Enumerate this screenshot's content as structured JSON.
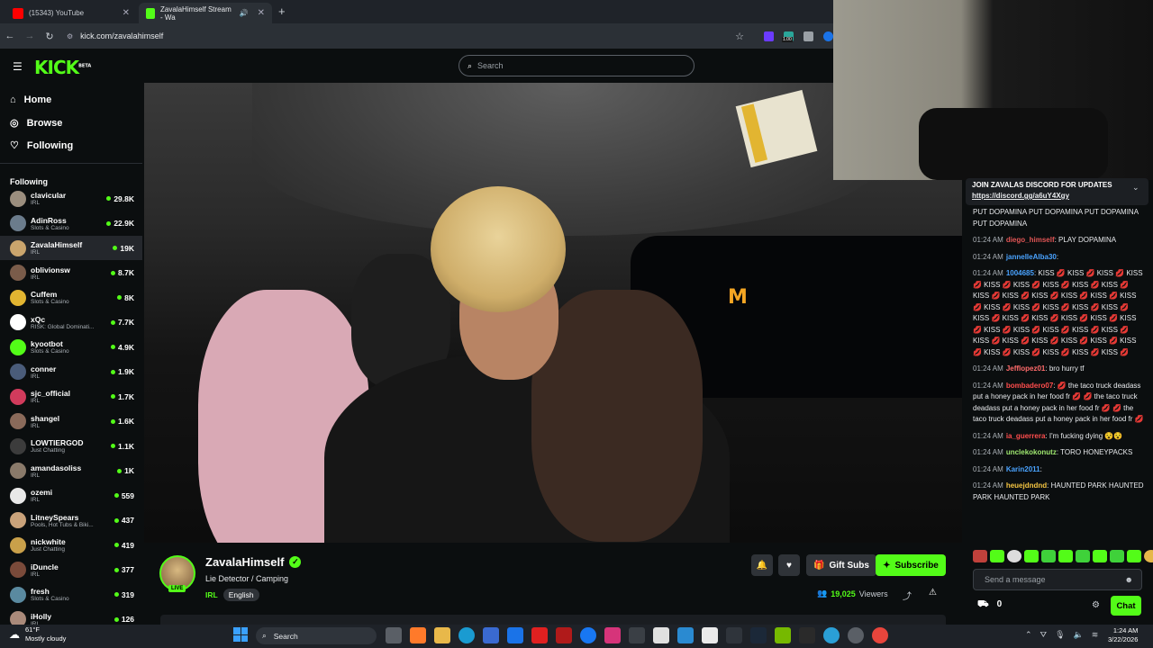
{
  "browser": {
    "tabs": [
      {
        "title": "(15343) YouTube",
        "icon_color": "#ff0000"
      },
      {
        "title": "ZavalaHimself Stream - Wa",
        "icon_color": "#53fc18"
      }
    ],
    "url": "kick.com/zavalahimself",
    "ext_badge": "1.00"
  },
  "header": {
    "logo": "KICK",
    "logo_tag": "BETA",
    "search_placeholder": "Search"
  },
  "nav": {
    "home": "Home",
    "browse": "Browse",
    "following": "Following"
  },
  "sidebar": {
    "title": "Following",
    "channels": [
      {
        "name": "clavicular",
        "category": "IRL",
        "viewers": "29.8K",
        "color": "#9b8e7e"
      },
      {
        "name": "AdinRoss",
        "category": "Slots & Casino",
        "viewers": "22.9K",
        "color": "#6b7c8c"
      },
      {
        "name": "ZavalaHimself",
        "category": "IRL",
        "viewers": "19K",
        "color": "#caa56d"
      },
      {
        "name": "oblivionsw",
        "category": "IRL",
        "viewers": "8.7K",
        "color": "#7a5c4a"
      },
      {
        "name": "Cuffem",
        "category": "Slots & Casino",
        "viewers": "8K",
        "color": "#e2b531"
      },
      {
        "name": "xQc",
        "category": "RISK: Global Dominati...",
        "viewers": "7.7K",
        "color": "#ffffff"
      },
      {
        "name": "kyootbot",
        "category": "Slots & Casino",
        "viewers": "4.9K",
        "color": "#53fc18"
      },
      {
        "name": "conner",
        "category": "IRL",
        "viewers": "1.9K",
        "color": "#4a5c7a"
      },
      {
        "name": "sjc_official",
        "category": "IRL",
        "viewers": "1.7K",
        "color": "#d13b5c"
      },
      {
        "name": "shangel",
        "category": "IRL",
        "viewers": "1.6K",
        "color": "#8a6a5a"
      },
      {
        "name": "LOWTIERGOD",
        "category": "Just Chatting",
        "viewers": "1.1K",
        "color": "#3c3c3c"
      },
      {
        "name": "amandasoliss",
        "category": "IRL",
        "viewers": "1K",
        "color": "#8a7a6a"
      },
      {
        "name": "ozemi",
        "category": "IRL",
        "viewers": "559",
        "color": "#e8e8e8"
      },
      {
        "name": "LitneySpears",
        "category": "Pools, Hot Tubs & Biki...",
        "viewers": "437",
        "color": "#c9a27a"
      },
      {
        "name": "nickwhite",
        "category": "Just Chatting",
        "viewers": "419",
        "color": "#c9a04a"
      },
      {
        "name": "iDuncle",
        "category": "IRL",
        "viewers": "377",
        "color": "#7a4a3a"
      },
      {
        "name": "fresh",
        "category": "Slots & Casino",
        "viewers": "319",
        "color": "#5a8aa0"
      },
      {
        "name": "iHolly",
        "category": "IRL",
        "viewers": "126",
        "color": "#aa8a7a"
      }
    ]
  },
  "stream": {
    "streamer": "ZavalaHimself",
    "live_badge": "LIVE",
    "title": "Lie Detector / Camping",
    "category": "IRL",
    "tag": "English",
    "gift_label": "Gift Subs",
    "subscribe_label": "Subscribe",
    "viewers_count": "19,025",
    "viewers_label": "Viewers",
    "video_sign": "M"
  },
  "chat": {
    "pinned_text": "JOIN ZAVALAS DISCORD FOR UPDATES",
    "pinned_link": "https://discord.gg/a6uY4Xgy",
    "messages": [
      {
        "time": "",
        "user": "",
        "user_color": "#e8eaed",
        "text": "PUT DOPAMINA PUT DOPAMINA PUT DOPAMINA PUT DOPAMINA"
      },
      {
        "time": "01:24 AM",
        "user": "diego_himself",
        "user_color": "#e05555",
        "text": ": PLAY DOPAMINA"
      },
      {
        "time": "01:24 AM",
        "user": "jannelleAlba30",
        "user_color": "#4aa3ff",
        "text": ":"
      },
      {
        "time": "01:24 AM",
        "user": "1004685",
        "user_color": "#4aa3ff",
        "text": ": KISS 💋 KISS 💋 KISS 💋 KISS 💋 KISS 💋 KISS 💋 KISS 💋 KISS 💋 KISS 💋 KISS 💋 KISS 💋 KISS 💋 KISS 💋 KISS 💋 KISS 💋 KISS 💋 KISS 💋 KISS 💋 KISS 💋 KISS 💋 KISS 💋 KISS 💋 KISS 💋 KISS 💋 KISS 💋 KISS 💋 KISS 💋 KISS 💋 KISS 💋 KISS 💋 KISS 💋 KISS 💋 KISS 💋 KISS 💋 KISS 💋 KISS 💋 KISS 💋 KISS 💋 KISS 💋 KISS 💋 KISS 💋 KISS 💋"
      },
      {
        "time": "01:24 AM",
        "user": "Jefflopez01",
        "user_color": "#ff6b6b",
        "text": ": bro hurry tf"
      },
      {
        "time": "01:24 AM",
        "user": "bombadero07",
        "user_color": "#ff4d4d",
        "text": ": 💋 the taco truck deadass put a honey pack in her food fr 💋 💋 the taco truck deadass put a honey pack in her food fr 💋 💋 the taco truck deadass put a honey pack in her food fr 💋"
      },
      {
        "time": "01:24 AM",
        "user": "ia_guerrera",
        "user_color": "#ff4d4d",
        "text": ": I'm fucking dying 😵😵"
      },
      {
        "time": "01:24 AM",
        "user": "unclekokonutz",
        "user_color": "#9fe870",
        "text": ": TORO HONEYPACKS"
      },
      {
        "time": "01:24 AM",
        "user": "Karin2011",
        "user_color": "#4aa3ff",
        "text": ":"
      },
      {
        "time": "01:24 AM",
        "user": "heuejdndnd",
        "user_color": "#f5c542",
        "text": ": HAUNTED PARK HAUNTED PARK HAUNTED PARK"
      }
    ],
    "input_placeholder": "Send a message",
    "user_count": "0",
    "send_label": "Chat"
  },
  "taskbar": {
    "temp": "61°F",
    "weather": "Mostly cloudy",
    "search": "Search",
    "time": "1:24 AM",
    "date": "3/22/2026"
  }
}
